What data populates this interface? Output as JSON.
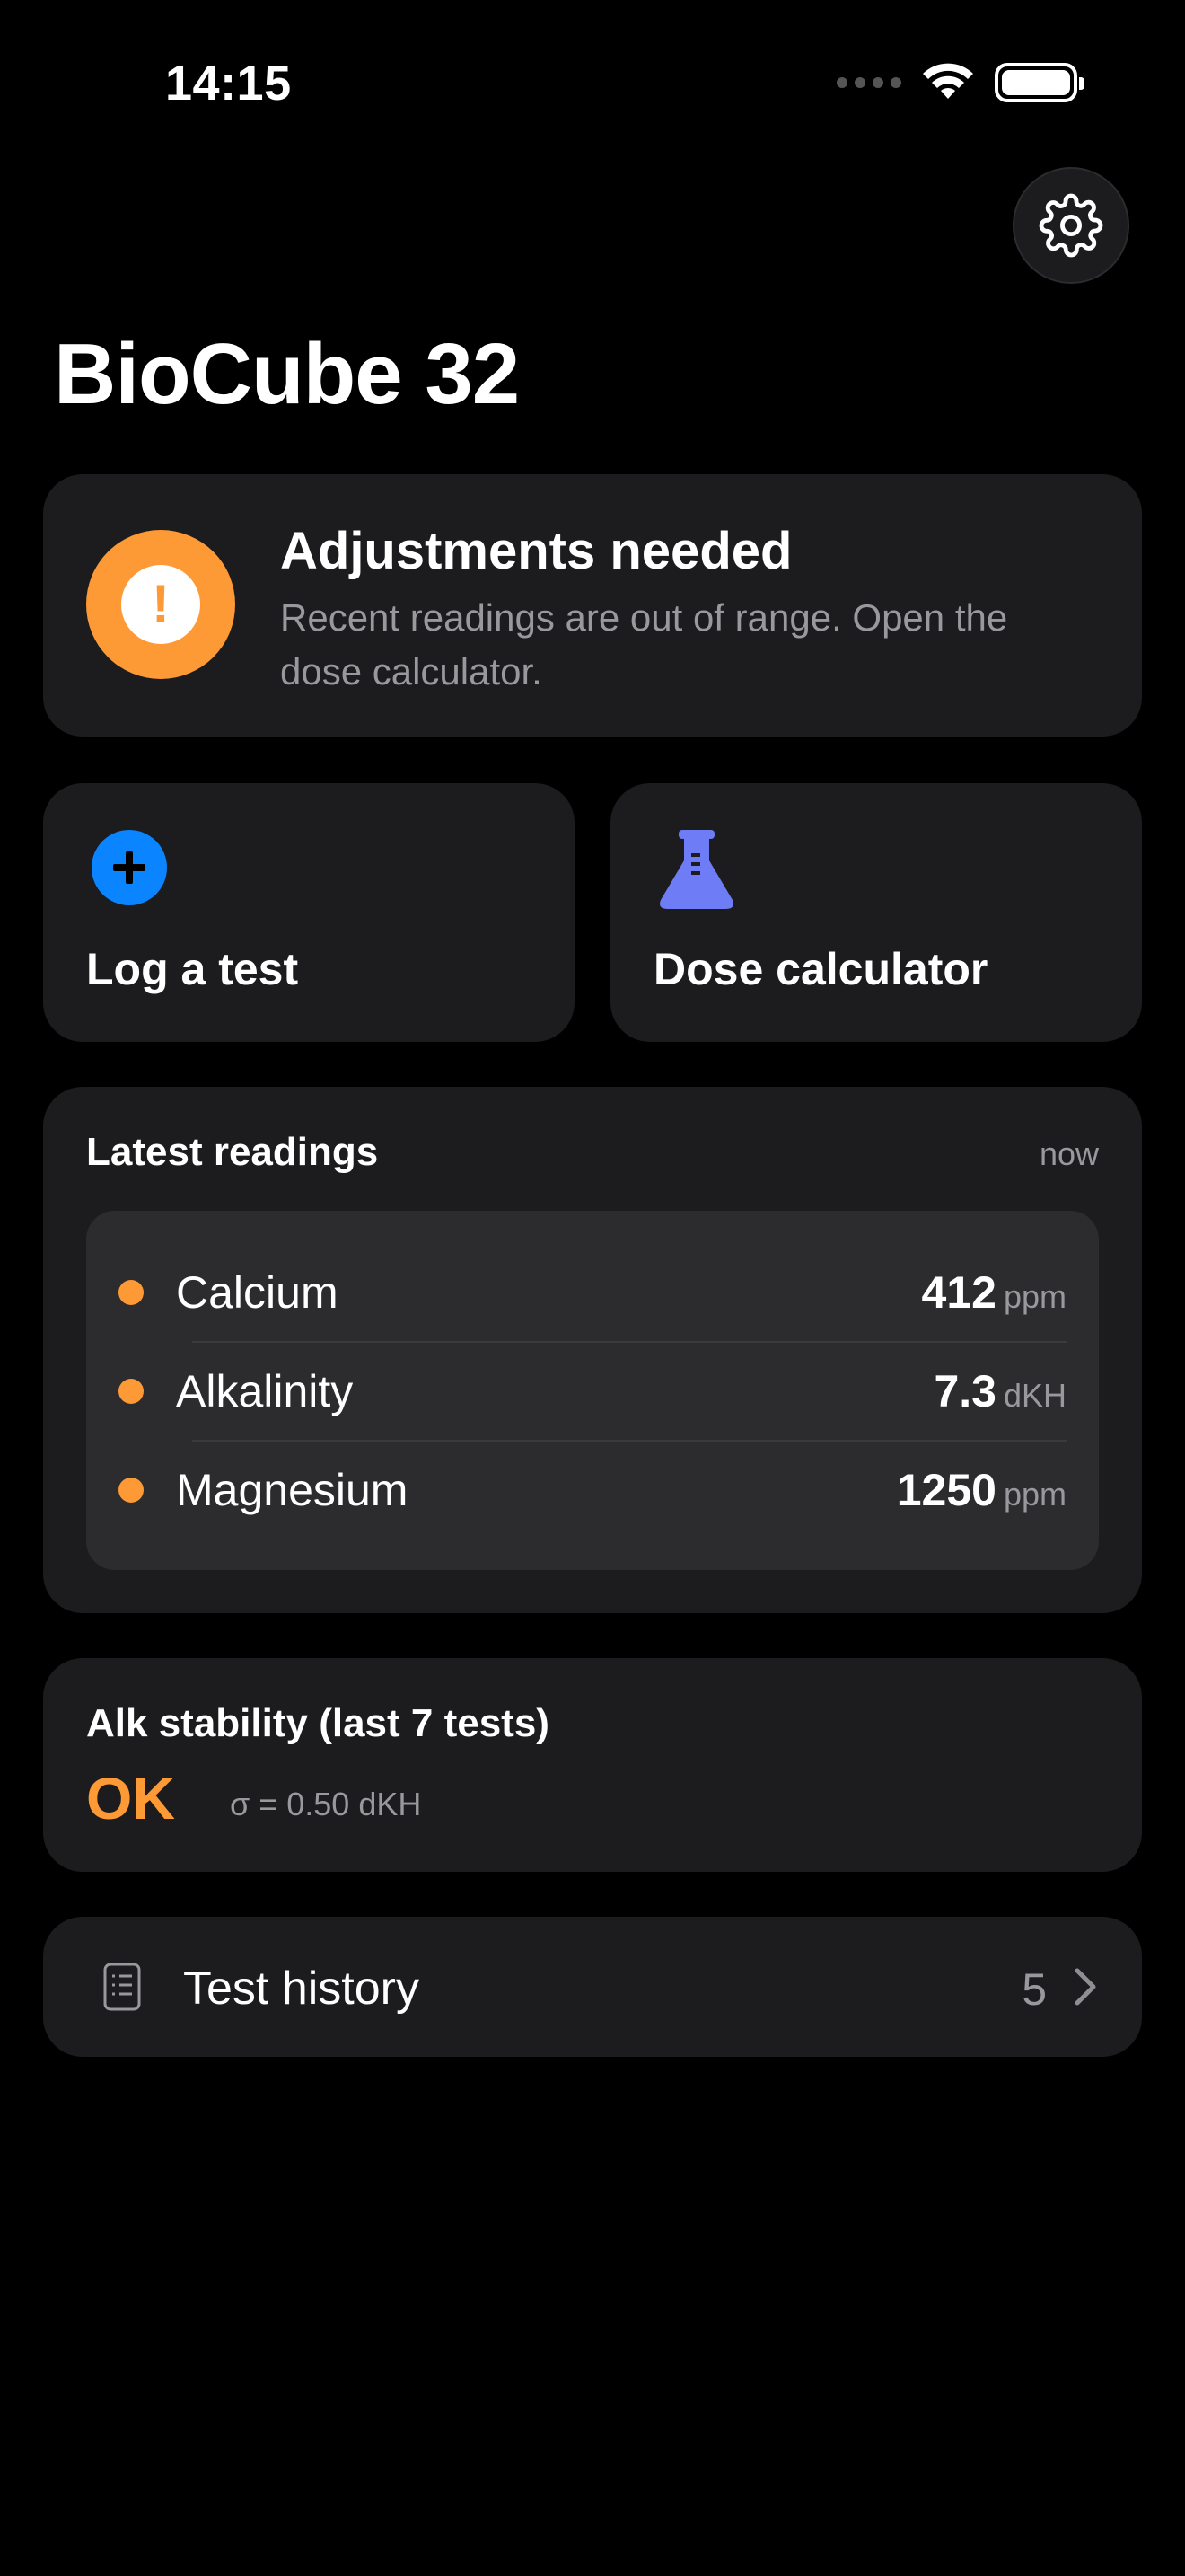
{
  "status_bar": {
    "time": "14:15"
  },
  "page": {
    "title": "BioCube 32"
  },
  "alert": {
    "title": "Adjustments needed",
    "message": "Recent readings are out of range. Open the dose calculator.",
    "color": "#fe9a35"
  },
  "actions": {
    "log_test": {
      "label": "Log a test",
      "icon": "plus-circle-icon",
      "color": "#0a84ff"
    },
    "dose_calculator": {
      "label": "Dose calculator",
      "icon": "flask-icon",
      "color": "#6e7cf5"
    }
  },
  "readings": {
    "title": "Latest readings",
    "timestamp": "now",
    "items": [
      {
        "name": "Calcium",
        "value": "412",
        "unit": "ppm",
        "status_color": "#fe9a35"
      },
      {
        "name": "Alkalinity",
        "value": "7.3",
        "unit": "dKH",
        "status_color": "#fe9a35"
      },
      {
        "name": "Magnesium",
        "value": "1250",
        "unit": "ppm",
        "status_color": "#fe9a35"
      }
    ]
  },
  "stability": {
    "title": "Alk stability (last 7 tests)",
    "status": "OK",
    "sigma": "σ = 0.50 dKH"
  },
  "history": {
    "label": "Test history",
    "count": "5"
  }
}
